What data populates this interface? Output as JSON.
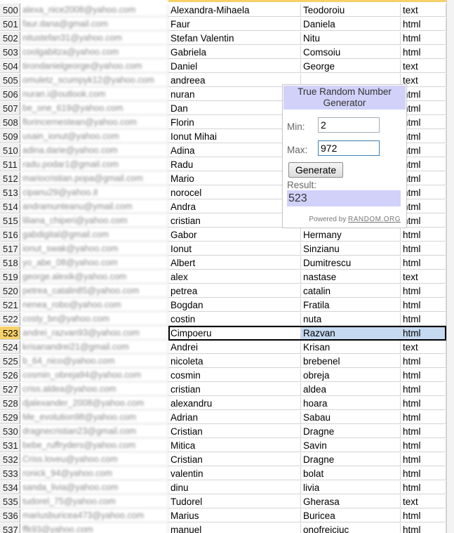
{
  "active_row": "523",
  "rows": [
    {
      "n": "500",
      "email": "alexa_nice2008@yahoo.com",
      "first": "Alexandra-Mihaela",
      "last": "Teodoroiu",
      "type": "text"
    },
    {
      "n": "501",
      "email": "faur.dana@gmail.com",
      "first": "Faur",
      "last": "Daniela",
      "type": "html"
    },
    {
      "n": "502",
      "email": "nitustefan31@yahoo.com",
      "first": "Stefan Valentin",
      "last": "Nitu",
      "type": "html"
    },
    {
      "n": "503",
      "email": "coolgabitza@yahoo.com",
      "first": "Gabriela",
      "last": "Comsoiu",
      "type": "html"
    },
    {
      "n": "504",
      "email": "tirondanielgeorge@yahoo.com",
      "first": "Daniel",
      "last": "George",
      "type": "text"
    },
    {
      "n": "505",
      "email": "omuletz_scumpyk12@yahoo.com",
      "first": "andreea",
      "last": "",
      "type": "text"
    },
    {
      "n": "506",
      "email": "nuran.i@outlook.com",
      "first": "nuran",
      "last": "",
      "type": "html"
    },
    {
      "n": "507",
      "email": "be_one_619@yahoo.com",
      "first": "Dan",
      "last": "",
      "type": "html"
    },
    {
      "n": "508",
      "email": "florincernestean@yahoo.com",
      "first": "Florin",
      "last": "",
      "type": "html"
    },
    {
      "n": "509",
      "email": "usain_ionut@yahoo.com",
      "first": "Ionut Mihai",
      "last": "",
      "type": "html"
    },
    {
      "n": "510",
      "email": "adina.darie@yahoo.com",
      "first": "Adina",
      "last": "",
      "type": "html"
    },
    {
      "n": "511",
      "email": "radu.podar1@gmail.com",
      "first": "Radu",
      "last": "",
      "type": "html"
    },
    {
      "n": "512",
      "email": "mariocristian.popa@gmail.com",
      "first": "Mario",
      "last": "",
      "type": "html"
    },
    {
      "n": "513",
      "email": "cipanu29@yahoo.it",
      "first": "norocel",
      "last": "",
      "type": "html"
    },
    {
      "n": "514",
      "email": "andramunteanu@ymail.com",
      "first": "Andra",
      "last": "",
      "type": "html"
    },
    {
      "n": "515",
      "email": "liliana_chiperi@yahoo.com",
      "first": "cristian",
      "last": "",
      "type": "html"
    },
    {
      "n": "516",
      "email": "gabdigital@gmail.com",
      "first": "Gabor",
      "last": "Hermany",
      "type": "html"
    },
    {
      "n": "517",
      "email": "ionut_swak@yahoo.com",
      "first": "Ionut",
      "last": "Sinzianu",
      "type": "html"
    },
    {
      "n": "518",
      "email": "yo_abe_08@yahoo.com",
      "first": "Albert",
      "last": "Dumitrescu",
      "type": "html"
    },
    {
      "n": "519",
      "email": "george.alexik@yahoo.com",
      "first": "alex",
      "last": "nastase",
      "type": "text"
    },
    {
      "n": "520",
      "email": "petrea_catalin85@yahoo.com",
      "first": "petrea",
      "last": "catalin",
      "type": "html"
    },
    {
      "n": "521",
      "email": "nenea_robo@yahoo.com",
      "first": "Bogdan",
      "last": "Fratila",
      "type": "html"
    },
    {
      "n": "522",
      "email": "costy_bn@yahoo.com",
      "first": "costin",
      "last": "nuta",
      "type": "html"
    },
    {
      "n": "523",
      "email": "andrei_razvan93@yahoo.com",
      "first": "Cimpoeru",
      "last": "Razvan",
      "type": "html"
    },
    {
      "n": "524",
      "email": "krisanandrei21@gmail.com",
      "first": "Andrei",
      "last": "Krisan",
      "type": "text"
    },
    {
      "n": "525",
      "email": "b_64_nico@yahoo.com",
      "first": "nicoleta",
      "last": "brebenel",
      "type": "html"
    },
    {
      "n": "526",
      "email": "cosmin_obreja94@yahoo.com",
      "first": "cosmin",
      "last": "obreja",
      "type": "html"
    },
    {
      "n": "527",
      "email": "criss.aldea@yahoo.com",
      "first": "cristian",
      "last": "aldea",
      "type": "html"
    },
    {
      "n": "528",
      "email": "djalexander_2008@yahoo.com",
      "first": "alexandru",
      "last": "hoara",
      "type": "html"
    },
    {
      "n": "529",
      "email": "Me_evolution98@yahoo.com",
      "first": "Adrian",
      "last": "Sabau",
      "type": "html"
    },
    {
      "n": "530",
      "email": "dragnecristian23@gmail.com",
      "first": "Cristian",
      "last": "Dragne",
      "type": "html"
    },
    {
      "n": "531",
      "email": "bebe_ruffryders@yahoo.com",
      "first": "Mitica",
      "last": "Savin",
      "type": "html"
    },
    {
      "n": "532",
      "email": "Criss.loveu@yahoo.com",
      "first": "Cristian",
      "last": "Dragne",
      "type": "html"
    },
    {
      "n": "533",
      "email": "ronick_94@yahoo.com",
      "first": "valentin",
      "last": "bolat",
      "type": "html"
    },
    {
      "n": "534",
      "email": "sanda_livia@yahoo.com",
      "first": "dinu",
      "last": "livia",
      "type": "html"
    },
    {
      "n": "535",
      "email": "tudorel_75@yahoo.com",
      "first": "Tudorel",
      "last": "Gherasa",
      "type": "text"
    },
    {
      "n": "536",
      "email": "mariusburicea473@yahoo.com",
      "first": "Marius",
      "last": "Buricea",
      "type": "html"
    },
    {
      "n": "537",
      "email": "ffk93@yahoo.com",
      "first": "manuel",
      "last": "onofreiciuc",
      "type": "html"
    }
  ],
  "widget": {
    "title": "True Random Number Generator",
    "min_label": "Min:",
    "min_value": "2",
    "max_label": "Max:",
    "max_value": "972",
    "button_label": "Generate",
    "result_label": "Result:",
    "result_value": "523",
    "powered_prefix": "Powered by",
    "powered_link": "RANDOM.ORG"
  },
  "colors": {
    "active_header": "#f7d069",
    "widget_accent": "#d1d1f9",
    "selection_fill": "#c5d9f1"
  }
}
